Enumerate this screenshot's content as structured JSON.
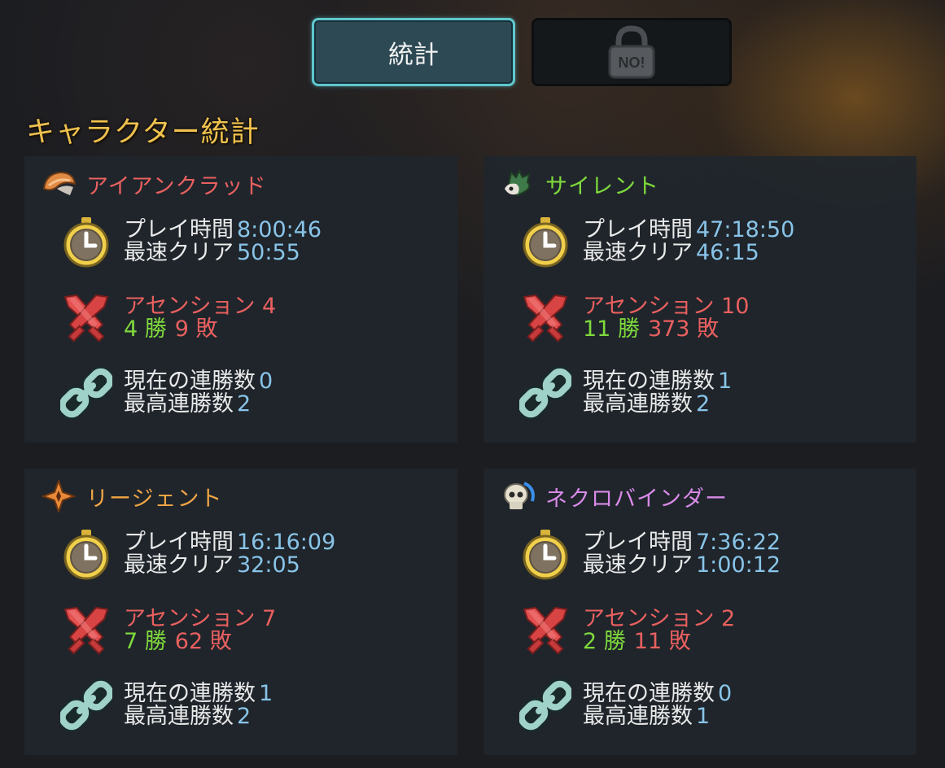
{
  "tabs": {
    "stats_label": "統計",
    "locked_badge": "NO!"
  },
  "section_title": "キャラクター統計",
  "labels": {
    "play_time": "プレイ時間",
    "fastest_clear": "最速クリア",
    "current_streak": "現在の連勝数",
    "best_streak": "最高連勝数"
  },
  "characters": [
    {
      "name": "アイアンクラッド",
      "name_color": "#e9605f",
      "icon": "ironclad-helmet-icon",
      "play_time": "8:00:46",
      "fastest_clear": "50:55",
      "ascension": "アセンション 4",
      "wins": "4 勝",
      "losses": "9 敗",
      "current_streak": "0",
      "best_streak": "2"
    },
    {
      "name": "サイレント",
      "name_color": "#7fd93c",
      "icon": "silent-skull-icon",
      "play_time": "47:18:50",
      "fastest_clear": "46:15",
      "ascension": "アセンション 10",
      "wins": "11 勝",
      "losses": "373 敗",
      "current_streak": "1",
      "best_streak": "2"
    },
    {
      "name": "リージェント",
      "name_color": "#f0a444",
      "icon": "regent-star-icon",
      "play_time": "16:16:09",
      "fastest_clear": "32:05",
      "ascension": "アセンション 7",
      "wins": "7 勝",
      "losses": "62 敗",
      "current_streak": "1",
      "best_streak": "2"
    },
    {
      "name": "ネクロバインダー",
      "name_color": "#d98ae8",
      "icon": "necrobinder-skull-icon",
      "play_time": "7:36:22",
      "fastest_clear": "1:00:12",
      "ascension": "アセンション 2",
      "wins": "2 勝",
      "losses": "11 敗",
      "current_streak": "0",
      "best_streak": "1"
    }
  ],
  "colors": {
    "accent_tab_border": "#5fc7cc",
    "title": "#f0c24e",
    "value": "#89c4e8",
    "win": "#7fd93c",
    "loss": "#e9605f"
  }
}
